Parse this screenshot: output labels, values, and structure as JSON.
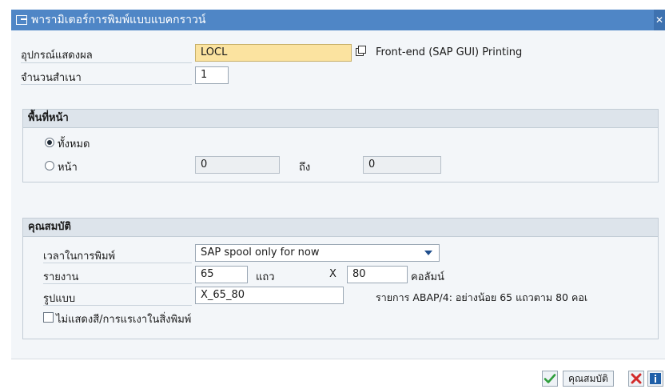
{
  "window": {
    "title": "พารามิเตอร์การพิมพ์แบบแบคกราวน์"
  },
  "device": {
    "label": "อุปกรณ์แสดงผล",
    "value": "LOCL",
    "description": "Front-end (SAP GUI) Printing"
  },
  "copies": {
    "label": "จำนวนสำเนา",
    "value": "1"
  },
  "page_area": {
    "title": "พื้นที่หน้า",
    "all_label": "ทั้งหมด",
    "page_label": "หน้า",
    "from_value": "0",
    "to_label": "ถึง",
    "to_value": "0",
    "selected": "all"
  },
  "properties": {
    "title": "คุณสมบัติ",
    "print_time_label": "เวลาในการพิมพ์",
    "print_time_value": "SAP spool only for now",
    "report_label": "รายงาน",
    "rows_value": "65",
    "rows_unit": "แถว",
    "x_label": "X",
    "cols_value": "80",
    "cols_unit": "คอลัมน์",
    "format_label": "รูปแบบ",
    "format_value": "X_65_80",
    "format_description": "รายการ ABAP/4: อย่างน้อย 65 แถวตาม 80 คอเ",
    "no_color_label": "ไม่แสดงสี/การแรเงาในสิ่งพิมพ์",
    "no_color_checked": false
  },
  "footer": {
    "properties_button": "คุณสมบัติ"
  },
  "colors": {
    "title_bar": "#4f86c6",
    "confirm": "#2e9e3b",
    "cancel": "#d22b2b",
    "info": "#1f5fa8",
    "device_highlight": "#fbe3a0"
  }
}
